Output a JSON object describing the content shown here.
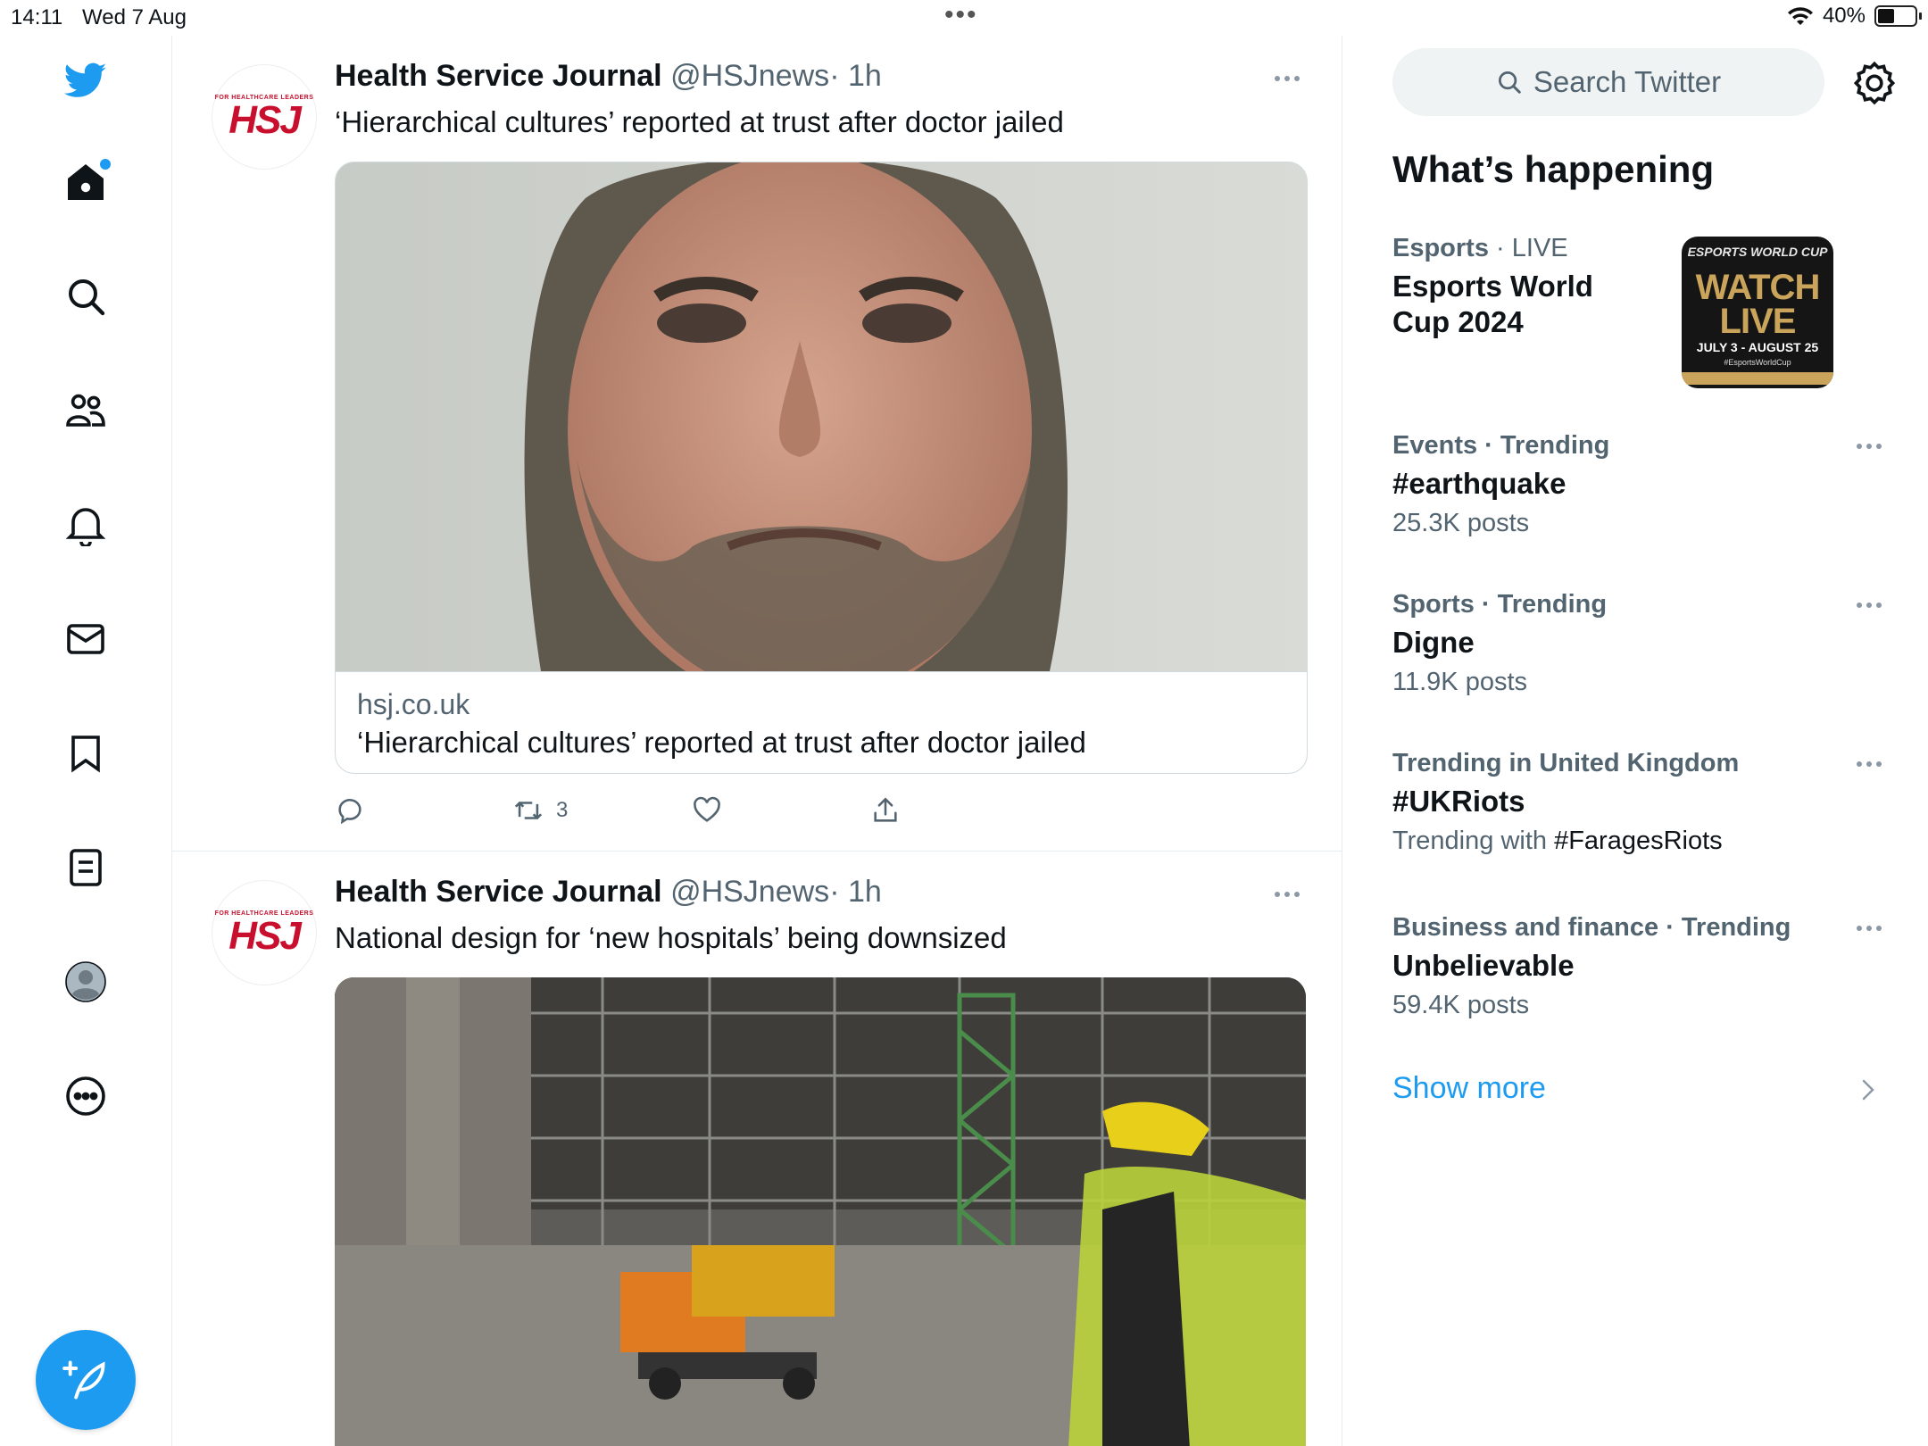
{
  "status": {
    "time": "14:11",
    "date": "Wed 7 Aug",
    "battery": "40%",
    "battery_level": 0.4
  },
  "nav": {
    "items": [
      "twitter-logo",
      "home-icon",
      "search-icon",
      "communities-icon",
      "notifications-icon",
      "messages-icon",
      "bookmarks-icon",
      "lists-icon",
      "profile-avatar",
      "more-icon"
    ]
  },
  "feed": {
    "tweets": [
      {
        "name": "Health Service Journal",
        "handle": "@HSJnews",
        "time": "· 1h",
        "text": "‘Hierarchical cultures’ reported at trust after doctor jailed",
        "card_domain": "hsj.co.uk",
        "card_title": "‘Hierarchical cultures’ reported at trust after doctor jailed",
        "retweets": "3",
        "avatar_tag": "FOR HEALTHCARE LEADERS",
        "avatar_logo": "HSJ"
      },
      {
        "name": "Health Service Journal",
        "handle": "@HSJnews",
        "time": "· 1h",
        "text": "National design for ‘new hospitals’ being downsized",
        "avatar_tag": "FOR HEALTHCARE LEADERS",
        "avatar_logo": "HSJ"
      }
    ]
  },
  "sidebar": {
    "search_placeholder": "Search Twitter",
    "title": "What’s happening",
    "featured": {
      "category": "Esports",
      "status": " · LIVE",
      "name": "Esports World Cup 2024",
      "thumb_line1": "ESPORTS WORLD CUP",
      "thumb_line2": "WATCH LIVE",
      "thumb_line3": "JULY 3 - AUGUST 25",
      "thumb_line4": "#EsportsWorldCup"
    },
    "trends": [
      {
        "category": "Events · Trending",
        "name": "#earthquake",
        "count": "25.3K posts"
      },
      {
        "category": "Sports · Trending",
        "name": "Digne",
        "count": "11.9K posts"
      },
      {
        "category": "Trending in United Kingdom",
        "name": "#UKRiots",
        "with_prefix": "Trending with",
        "with_tag": "#FaragesRiots"
      },
      {
        "category": "Business and finance · Trending",
        "name": "Unbelievable",
        "count": "59.4K posts"
      }
    ],
    "show_more": "Show more"
  },
  "colors": {
    "accent": "#1d9bf0",
    "text": "#0f1419",
    "muted": "#536471",
    "border": "#e6ecf0"
  }
}
